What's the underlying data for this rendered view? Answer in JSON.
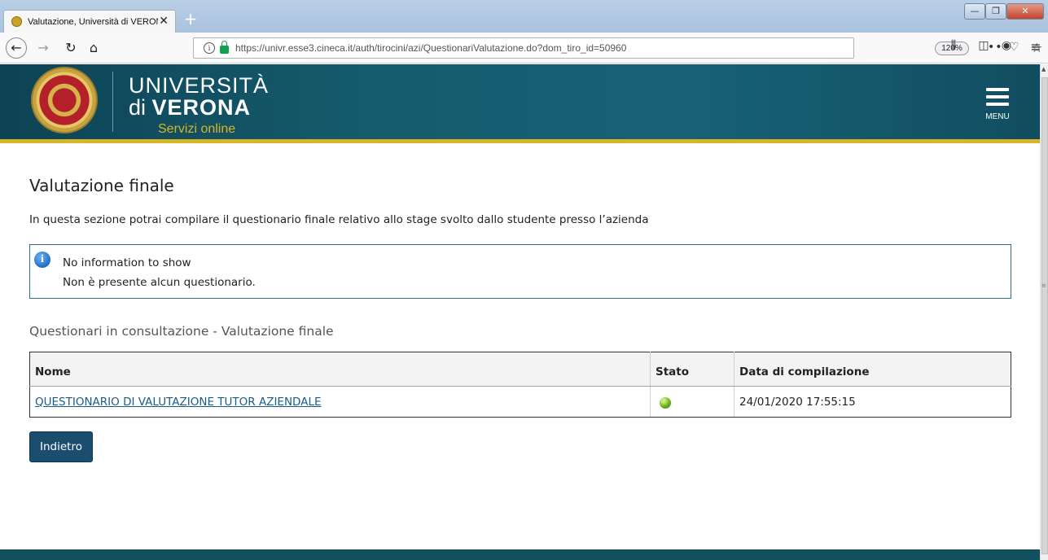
{
  "browser": {
    "tab_title": "Valutazione, Università di VERONA",
    "tab_close": "✕",
    "new_tab": "+",
    "url": "https://univr.esse3.cineca.it/auth/tirocini/azi/QuestionariValutazione.do?dom_tiro_id=50960",
    "zoom": "120%",
    "more": "•••",
    "win_min": "—",
    "win_max": "❐",
    "win_close": "✕"
  },
  "header": {
    "uni_line1": "UNIVERSITÀ",
    "uni_line2_prefix": "di ",
    "uni_line2_bold": "VERONA",
    "services": "Servizi online",
    "menu_label": "MENU"
  },
  "page": {
    "title": "Valutazione finale",
    "intro": "In questa sezione potrai compilare il questionario finale relativo allo stage svolto dallo studente presso l’azienda"
  },
  "info_box": {
    "title": "No information to show",
    "message": "Non è presente alcun questionario."
  },
  "section": {
    "title": "Questionari in consultazione - Valutazione finale"
  },
  "table": {
    "columns": [
      "Nome",
      "Stato",
      "Data di compilazione"
    ],
    "rows": [
      {
        "nome": "QUESTIONARIO DI VALUTAZIONE TUTOR AZIENDALE",
        "stato": "compilato",
        "stato_color": "#6fae25",
        "data": "24/01/2020 17:55:15"
      }
    ]
  },
  "actions": {
    "back_label": "Indietro"
  },
  "colors": {
    "header_bg": "#155b6d",
    "header_accent": "#d8b526",
    "button_bg": "#1b4e6e",
    "link": "#1a5c88"
  }
}
